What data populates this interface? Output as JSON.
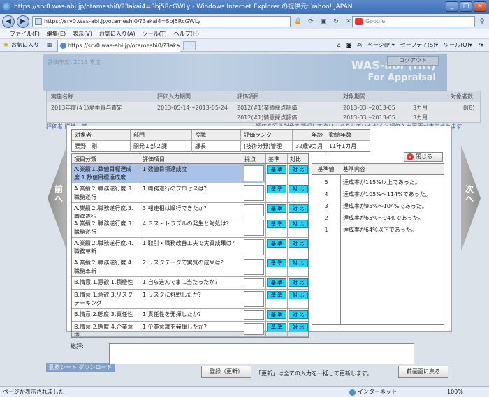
{
  "window": {
    "title": "https://srv0.was-abi.jp/otameshi0/?3akai4=Sbj5RcGWLy - Windows Internet Explorer の提供元: Yahoo! JAPAN",
    "address": "https://srv0.was-abi.jp/otameshi0/?3akai4=Sbj5RcGWLy",
    "search_placeholder": "Google",
    "tab_title": "https://srv0.was-abi.jp/otameshi0/?3akai4=Sbj5Rc...",
    "favorites": "お気に入り",
    "menu": [
      "ファイル(F)",
      "編集(E)",
      "表示(V)",
      "お気に入り(A)",
      "ツール(T)",
      "ヘルプ(H)"
    ],
    "commands": [
      "ページ(P)▾",
      "セーフティ(S)▾",
      "ツール(O)▾",
      "?▾"
    ]
  },
  "background": {
    "crumb": "評価年度: 2013 年度",
    "logo_line1": "WAS-abi (HR)",
    "logo_line2": "For Appraisal",
    "logout": "ログアウト",
    "table_headers": [
      "実施名称",
      "評価入力期間",
      "評価項目",
      "対象期間",
      "対象者数"
    ],
    "rows": [
      [
        "2013年度(#1)夏季賞与査定",
        "2013-05-14～2013-05-24",
        "2012(#1)業績採点評価",
        "2013-03～2013-05",
        "3カ月",
        "8(8)"
      ],
      [
        "",
        "",
        "2012(#1)情意採点評価",
        "2013-03～2013-05",
        "3カ月",
        ""
      ]
    ],
    "link_left": "評価者 勝横　可",
    "link_right": "評価を行う対象を選択してクリックをしていただくと評価入力画面が表示されます",
    "bottom_left": "勤務シート ダウンロード"
  },
  "info": {
    "headers": [
      "対象者",
      "部門",
      "役職",
      "評価ランク",
      "年齢",
      "勤続年数"
    ],
    "values": [
      "腰野　剛",
      "開発１部２課",
      "課長",
      "(技術分野)管理",
      "32歳9カ月",
      "11年1カ月"
    ]
  },
  "close_label": "閉じる",
  "table": {
    "headers": [
      "項目分類",
      "評価項目",
      "採点",
      "基準",
      "対比"
    ],
    "rows": [
      {
        "cat": "A.業績１.数値目標達成度.1.数値目標達成度",
        "item": "1.数値目標達成度",
        "kijun": "基 準",
        "taihi": "対 比",
        "selected": true
      },
      {
        "cat": "A.業績２.職務遂行度.3.職務遂行",
        "item": "1.職務遂行のプロセスは？",
        "kijun": "基 準",
        "taihi": "対 比"
      },
      {
        "cat": "A.業績２.職務遂行度.3.職務遂行",
        "item": "3.報連相は順行できたか？",
        "kijun": "基 準",
        "taihi": "対 比"
      },
      {
        "cat": "A.業績２.職務遂行度.3.職務遂行",
        "item": "4.ミス・トラブルの発生と対処は？",
        "kijun": "基 準",
        "taihi": "対 比"
      },
      {
        "cat": "A.業績２.職務遂行度.4.職務革新",
        "item": "1.取引・職務改善工夫で実質成果は？",
        "kijun": "基 準",
        "taihi": "対 比"
      },
      {
        "cat": "A.業績２.職務遂行度.4.職務革新",
        "item": "2.リスクテークで実質の成果は？",
        "kijun": "基 準",
        "taihi": "対 比"
      },
      {
        "cat": "B.情意.1.意欲.1.積極性",
        "item": "1.自ら進んで事に当たったか？",
        "kijun": "基 準",
        "taihi": "対 比"
      },
      {
        "cat": "B.情意.1.意欲.3.リスクテーキング",
        "item": "1.リスクに挑戦したか？",
        "kijun": "基 準",
        "taihi": "対 比"
      },
      {
        "cat": "B.情意.2.態度.3.責任性",
        "item": "1.責任性を発揮したか？",
        "kijun": "基 準",
        "taihi": "対 比"
      },
      {
        "cat": "B.情意.2.態度.4.企業意識",
        "item": "1.企業意識を発揮したか？",
        "kijun": "基 準",
        "taihi": "対 比"
      }
    ]
  },
  "criteria": {
    "headers": [
      "基準値",
      "基準内容"
    ],
    "rows": [
      [
        "5",
        "達成率が115%以上であった。"
      ],
      [
        "4",
        "達成率が105%～114%であった。"
      ],
      [
        "3",
        "達成率が95%～104%であった。"
      ],
      [
        "2",
        "達成率が65%～94%であった。"
      ],
      [
        "1",
        "達成率が64%以下であった。"
      ]
    ]
  },
  "comment_label": "総評:",
  "register_button": "登録（更新）",
  "register_note": "「更新」は全ての入力を一括して更新します。",
  "back_button": "前画面に戻る",
  "prev_label": "前へ",
  "next_label": "次へ",
  "status": {
    "text": "ページが表示されました",
    "zone": "インターネット",
    "zoom": "100%"
  }
}
